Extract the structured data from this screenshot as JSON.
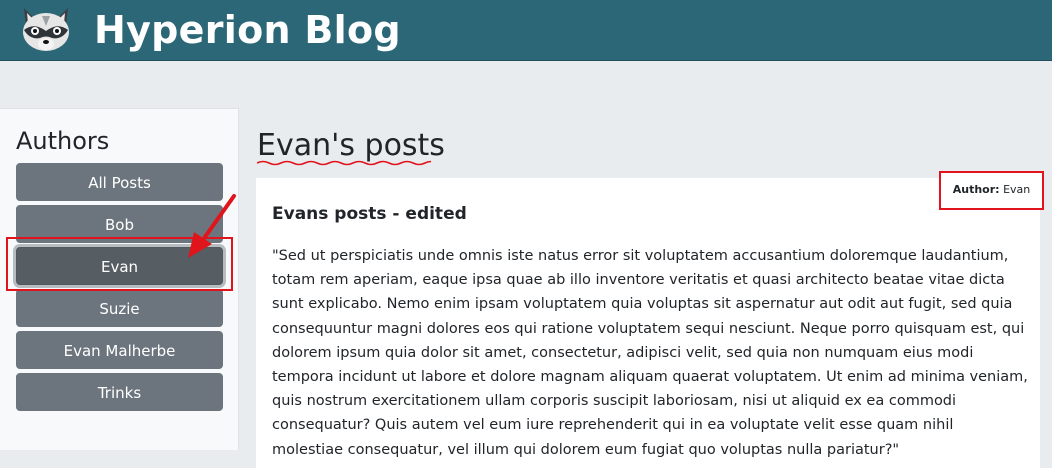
{
  "header": {
    "logo_icon": "raccoon-logo-icon",
    "title": "Hyperion Blog",
    "background_color": "#2b6777"
  },
  "sidebar": {
    "title": "Authors",
    "items": [
      {
        "label": "All Posts",
        "active": false
      },
      {
        "label": "Bob",
        "active": false
      },
      {
        "label": "Evan",
        "active": true
      },
      {
        "label": "Suzie",
        "active": false
      },
      {
        "label": "Evan Malherbe",
        "active": false
      },
      {
        "label": "Trinks",
        "active": false
      }
    ]
  },
  "main": {
    "heading": "Evan's posts",
    "post": {
      "author_label": "Author:",
      "author_name": "Evan",
      "title": "Evans posts - edited",
      "body": "\"Sed ut perspiciatis unde omnis iste natus error sit voluptatem accusantium doloremque laudantium, totam rem aperiam, eaque ipsa quae ab illo inventore veritatis et quasi architecto beatae vitae dicta sunt explicabo. Nemo enim ipsam voluptatem quia voluptas sit aspernatur aut odit aut fugit, sed quia consequuntur magni dolores eos qui ratione voluptatem sequi nesciunt. Neque porro quisquam est, qui dolorem ipsum quia dolor sit amet, consectetur, adipisci velit, sed quia non numquam eius modi tempora incidunt ut labore et dolore magnam aliquam quaerat voluptatem. Ut enim ad minima veniam, quis nostrum exercitationem ullam corporis suscipit laboriosam, nisi ut aliquid ex ea commodi consequatur? Quis autem vel eum iure reprehenderit qui in ea voluptate velit esse quam nihil molestiae consequatur, vel illum qui dolorem eum fugiat quo voluptas nulla pariatur?\""
    }
  },
  "annotations": {
    "highlight_color": "#e0141b",
    "arrow_icon": "red-arrow-icon"
  }
}
